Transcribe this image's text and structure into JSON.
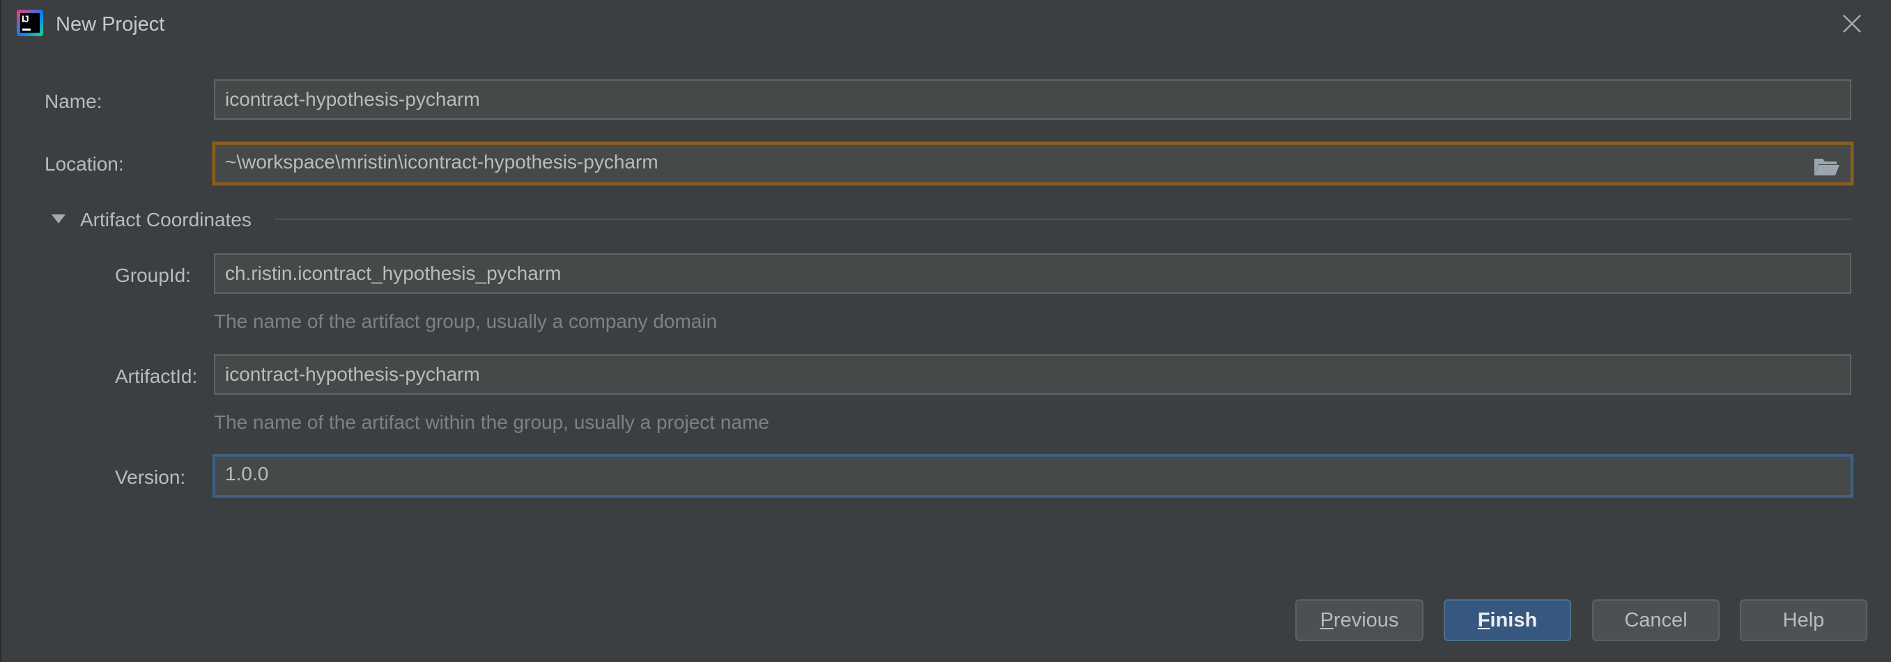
{
  "window": {
    "title": "New Project",
    "app_icon": "intellij-idea-icon",
    "app_icon_letters": "IJ"
  },
  "form": {
    "name": {
      "label": "Name:",
      "value": "icontract-hypothesis-pycharm"
    },
    "location": {
      "label": "Location:",
      "value": "~\\workspace\\mristin\\icontract-hypothesis-pycharm",
      "button_icon": "folder-open-icon"
    }
  },
  "artifact_section": {
    "title": "Artifact Coordinates",
    "expanded": true,
    "group_id": {
      "label": "GroupId:",
      "value": "ch.ristin.icontract_hypothesis_pycharm",
      "hint": "The name of the artifact group, usually a company domain"
    },
    "artifact_id": {
      "label": "ArtifactId:",
      "value": "icontract-hypothesis-pycharm",
      "hint": "The name of the artifact within the group, usually a project name"
    },
    "version": {
      "label": "Version:",
      "value": "1.0.0"
    }
  },
  "buttons": {
    "previous": {
      "mnemonic": "P",
      "rest": "revious"
    },
    "finish": {
      "mnemonic": "F",
      "rest": "inish"
    },
    "cancel": "Cancel",
    "help": "Help"
  },
  "colors": {
    "background": "#3c3f41",
    "field_background": "#45494a",
    "warning_border": "#8a5f1c",
    "focus_border": "#3d6185",
    "primary_button": "#365880"
  }
}
